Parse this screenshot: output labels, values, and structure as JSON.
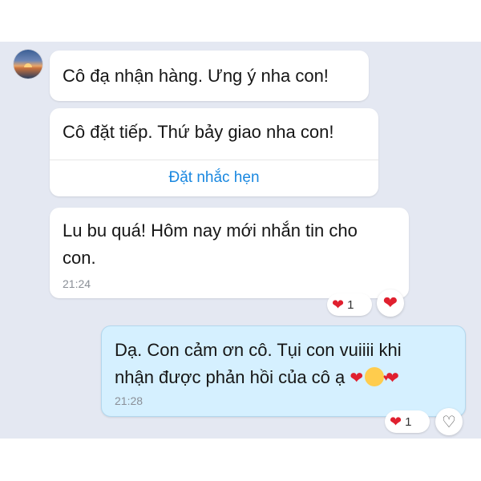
{
  "contact": {
    "avatar_icon": "sunset-avatar"
  },
  "messages": [
    {
      "text": "Cô đạ nhận hàng. Ưng ý nha con!"
    },
    {
      "text": "Cô đặt tiếp. Thứ bảy giao nha con!",
      "action_label": "Đặt nhắc hẹn"
    },
    {
      "text_line1": "Lu bu quá! Hôm nay mới nhắn tin cho",
      "text_line2": "con.",
      "time": "21:24",
      "reaction_count": "1"
    },
    {
      "text_line1": "Dạ. Con cảm ơn cô. Tụi con vuiiii khi",
      "text_line2": "nhận được phản hồi của cô ạ",
      "time": "21:28",
      "reaction_count": "1"
    }
  ],
  "colors": {
    "chat_background": "#e4e8f2",
    "outgoing_bubble": "#d5f0ff",
    "link": "#1a88e0",
    "heart": "#e0202f"
  }
}
